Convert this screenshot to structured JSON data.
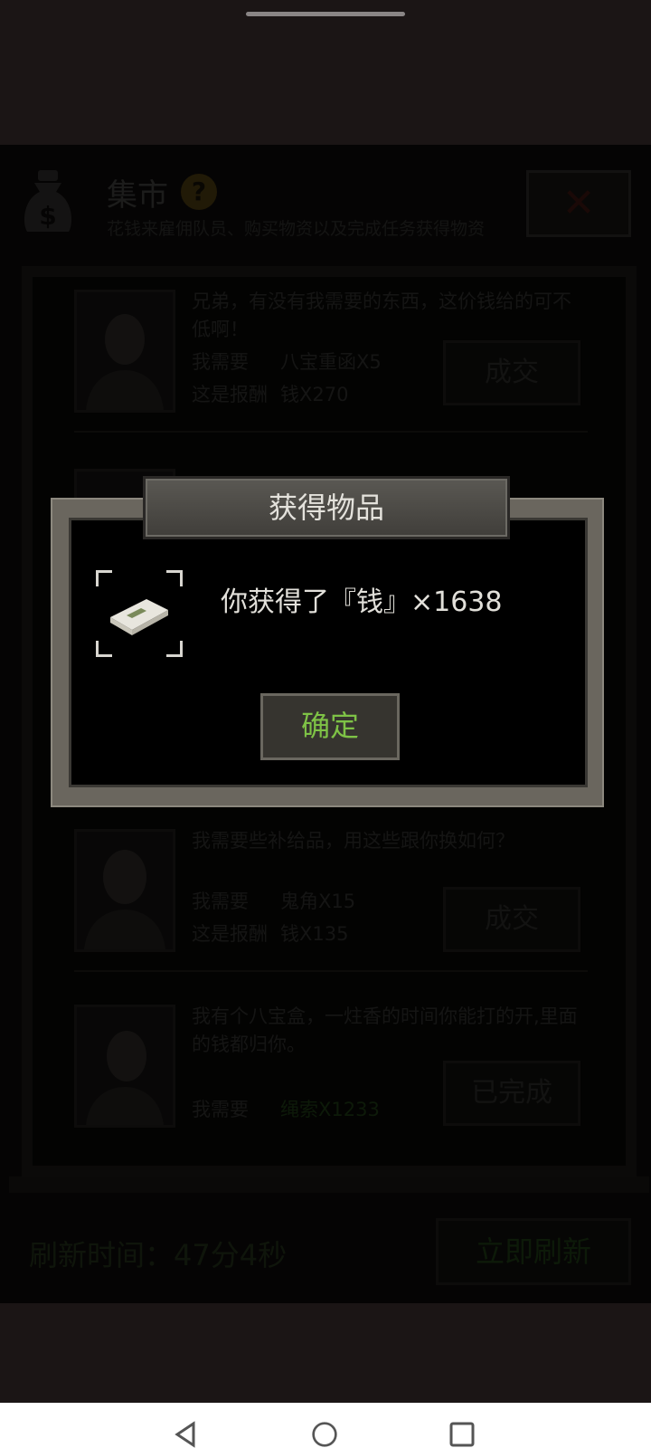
{
  "header": {
    "title": "集市",
    "help_icon_glyph": "?",
    "subtitle": "花钱来雇佣队员、购买物资以及完成任务获得物资",
    "close_glyph": "✕"
  },
  "offers": [
    {
      "text": "兄弟，有没有我需要的东西，这价钱给的可不低啊！",
      "need_label": "我需要",
      "need_value": "八宝重函X5",
      "reward_label": "这是报酬",
      "reward_value": "钱X270",
      "button": "成交"
    },
    {
      "text": "我需要些补给品，用这些跟你换如何？",
      "need_label": "我需要",
      "need_value": "鬼角X15",
      "reward_label": "这是报酬",
      "reward_value": "钱X135",
      "button": "成交"
    },
    {
      "text": "我有个八宝盒，一炷香的时间你能打的开,里面的钱都归你。",
      "need_label": "我需要",
      "need_value": "绳索X1233",
      "button": "已完成"
    }
  ],
  "refresh": {
    "label": "刷新时间：47分4秒",
    "button": "立即刷新"
  },
  "dialog": {
    "title": "获得物品",
    "reward_text": "你获得了『钱』×1638",
    "confirm": "确定"
  },
  "colors": {
    "confirm_text": "#7ec246",
    "completed_green": "#1e3a14"
  }
}
